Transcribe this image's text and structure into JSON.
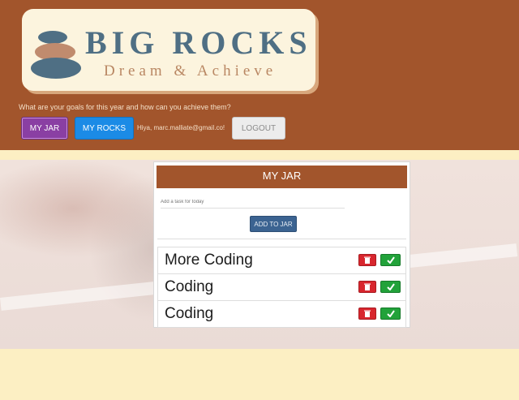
{
  "logo": {
    "title": "BIG ROCKS",
    "subtitle": "Dream & Achieve"
  },
  "header": {
    "tagline": "What are your goals for this year and how can you achieve them?",
    "nav": {
      "my_jar": "MY JAR",
      "my_rocks": "MY ROCKS",
      "greeting": "Hiya, marc.malliate@gmail.co!",
      "logout": "LOGOUT"
    }
  },
  "jar": {
    "title": "MY JAR",
    "input_placeholder": "Add a task for today",
    "add_button": "ADD TO JAR",
    "tasks": [
      {
        "text": "More Coding",
        "delete_icon": "trash-icon",
        "complete_icon": "check-icon"
      },
      {
        "text": "Coding",
        "delete_icon": "trash-icon",
        "complete_icon": "check-icon"
      },
      {
        "text": "Coding",
        "delete_icon": "trash-icon",
        "complete_icon": "check-icon"
      }
    ]
  },
  "colors": {
    "header_bg": "#a2552c",
    "page_bg": "#fcefc3",
    "jar_button": "#8a3fa3",
    "rocks_button": "#1b8be6",
    "add_button": "#3b6391",
    "delete": "#d8262e",
    "complete": "#22a23a"
  }
}
